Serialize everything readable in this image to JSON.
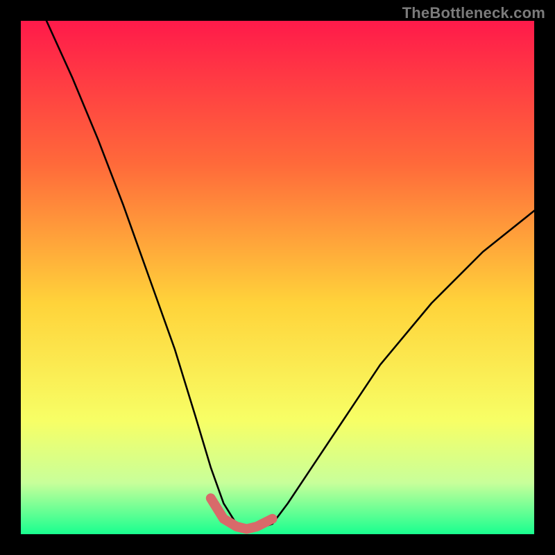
{
  "watermark": "TheBottleneck.com",
  "colors": {
    "frame_bg": "#000000",
    "curve": "#000000",
    "highlight": "#d86a6a",
    "gradient_stops": [
      {
        "offset": 0.0,
        "color": "#ff1a4a"
      },
      {
        "offset": 0.28,
        "color": "#ff6a3a"
      },
      {
        "offset": 0.55,
        "color": "#ffd33a"
      },
      {
        "offset": 0.78,
        "color": "#f7ff66"
      },
      {
        "offset": 0.9,
        "color": "#c8ff9a"
      },
      {
        "offset": 1.0,
        "color": "#19ff8f"
      }
    ]
  },
  "chart_data": {
    "type": "line",
    "title": "",
    "xlabel": "",
    "ylabel": "",
    "xlim": [
      0,
      100
    ],
    "ylim": [
      0,
      100
    ],
    "grid": false,
    "x": [
      5,
      10,
      15,
      20,
      25,
      30,
      34,
      37,
      39.5,
      42,
      44,
      46,
      49,
      52,
      56,
      62,
      70,
      80,
      90,
      100
    ],
    "bottleneck": [
      100,
      89,
      77,
      64,
      50,
      36,
      23,
      13,
      6,
      2,
      1,
      1,
      2,
      6,
      12,
      21,
      33,
      45,
      55,
      63
    ],
    "optimal_segment_x": [
      37,
      39.5,
      42,
      44,
      46,
      49
    ],
    "optimal_segment_y": [
      7,
      3,
      1.5,
      1,
      1.5,
      3
    ],
    "notes": "x is an unlabeled horizontal parameter (0–100 left→right); y is bottleneck % (0 at bottom/green, 100 at top/red). Values estimated from pixel positions."
  }
}
